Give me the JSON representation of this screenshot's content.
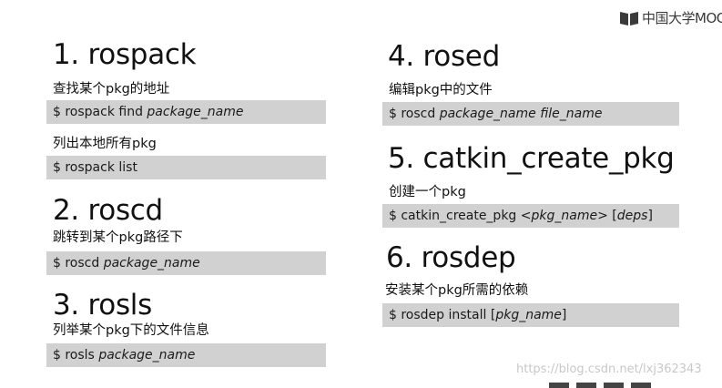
{
  "branding": {
    "logo_text": "中国大学MOOC"
  },
  "left": [
    {
      "title": "1. rospack",
      "desc": "查找某个pkg的地址",
      "cmd": [
        {
          "t": "$ rospack find ",
          "i": false
        },
        {
          "t": "package_name",
          "i": true
        }
      ]
    },
    {
      "title": "",
      "desc": "列出本地所有pkg",
      "cmd": [
        {
          "t": "$ rospack list",
          "i": false
        }
      ]
    },
    {
      "title": "2. roscd",
      "desc": "跳转到某个pkg路径下",
      "cmd": [
        {
          "t": "$ roscd ",
          "i": false
        },
        {
          "t": "package_name",
          "i": true
        }
      ]
    },
    {
      "title": "3. rosls",
      "desc": "列举某个pkg下的文件信息",
      "cmd": [
        {
          "t": "$ rosls ",
          "i": false
        },
        {
          "t": "package_name",
          "i": true
        }
      ]
    }
  ],
  "right": [
    {
      "title": "4. rosed",
      "desc": "编辑pkg中的文件",
      "cmd": [
        {
          "t": "$ roscd ",
          "i": false
        },
        {
          "t": "package_name file_name",
          "i": true
        }
      ]
    },
    {
      "title": "5. catkin_create_pkg",
      "desc": "创建一个pkg",
      "cmd": [
        {
          "t": "$ catkin_create_pkg <",
          "i": false
        },
        {
          "t": "pkg_name",
          "i": true
        },
        {
          "t": "> [",
          "i": false
        },
        {
          "t": "deps",
          "i": true
        },
        {
          "t": "]",
          "i": false
        }
      ]
    },
    {
      "title": "6. rosdep",
      "desc": "安装某个pkg所需的依赖",
      "cmd": [
        {
          "t": "$ rosdep install [",
          "i": false
        },
        {
          "t": "pkg_name",
          "i": true
        },
        {
          "t": "]",
          "i": false
        }
      ]
    }
  ],
  "watermark": "https://blog.csdn.net/lxj362343"
}
